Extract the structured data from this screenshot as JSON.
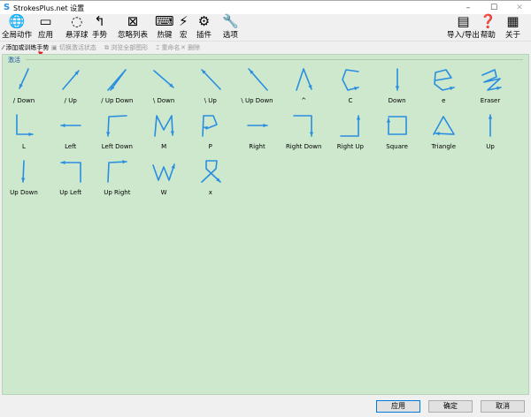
{
  "window": {
    "title": "StrokesPlus.net 设置",
    "minimize": "–",
    "maximize": "☐",
    "close": "✕"
  },
  "toolbar": {
    "left": [
      {
        "label": "全局动作",
        "icon": "globe-icon",
        "glyph": "🌐"
      },
      {
        "label": "应用",
        "icon": "window-icon",
        "glyph": "▭"
      },
      {
        "label": "悬浮球",
        "icon": "circle-dots-icon",
        "glyph": "◌"
      },
      {
        "label": "手势",
        "icon": "gesture-icon",
        "glyph": "↰"
      },
      {
        "label": "忽略列表",
        "icon": "ignore-list-icon",
        "glyph": "⊠"
      },
      {
        "label": "热键",
        "icon": "keyboard-icon",
        "glyph": "⌨"
      },
      {
        "label": "宏",
        "icon": "macro-icon",
        "glyph": "⚡"
      },
      {
        "label": "插件",
        "icon": "plugin-icon",
        "glyph": "⚙"
      },
      {
        "label": "选项",
        "icon": "wrench-icon",
        "glyph": "🔧"
      }
    ],
    "right": [
      {
        "label": "导入/导出",
        "icon": "import-export-icon",
        "glyph": "▤"
      },
      {
        "label": "帮助",
        "icon": "help-icon",
        "glyph": "❓"
      },
      {
        "label": "关于",
        "icon": "about-icon",
        "glyph": "▦"
      }
    ]
  },
  "subtoolbar": [
    {
      "label": "添加或训练手势",
      "enabled": true,
      "icon": "wand-icon",
      "glyph": "⁄"
    },
    {
      "label": "切换激活状态",
      "enabled": false,
      "icon": "toggle-icon",
      "glyph": "▣"
    },
    {
      "label": "浏览全部图形",
      "enabled": false,
      "icon": "browse-icon",
      "glyph": "⧉"
    },
    {
      "label": "重命名",
      "enabled": false,
      "icon": "rename-icon",
      "glyph": "⌶"
    },
    {
      "label": "删除",
      "enabled": false,
      "icon": "delete-icon",
      "glyph": "✕"
    }
  ],
  "group": {
    "label": "激活"
  },
  "stroke_color": "#2a8ee0",
  "gestures": [
    "/ Down",
    "/ Up",
    "/ Up Down",
    "\\ Down",
    "\\ Up",
    "\\ Up Down",
    "^",
    "C",
    "Down",
    "e",
    "Eraser",
    "L",
    "Left",
    "Left Down",
    "M",
    "P",
    "Right",
    "Right Down",
    "Right Up",
    "Square",
    "Triangle",
    "Up",
    "Up Down",
    "Up Left",
    "Up Right",
    "W",
    "x"
  ],
  "buttons": {
    "apply": "应用",
    "ok": "确定",
    "cancel": "取消"
  }
}
